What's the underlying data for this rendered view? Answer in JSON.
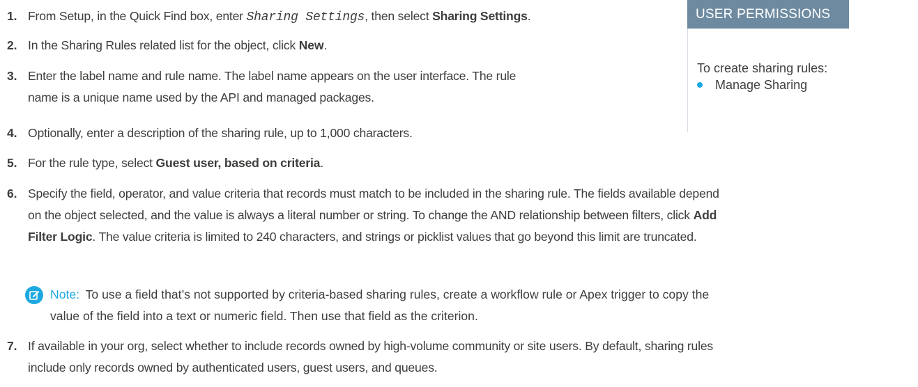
{
  "steps": [
    {
      "num": "1.",
      "parts": {
        "a": "From Setup, in the Quick Find box, enter ",
        "code": "Sharing Settings",
        "b": ", then select ",
        "bold": "Sharing Settings",
        "c": "."
      }
    },
    {
      "num": "2.",
      "parts": {
        "a": "In the Sharing Rules related list for the object, click ",
        "bold": "New",
        "b": "."
      }
    },
    {
      "num": "3.",
      "line1": "Enter the label name and rule name. The label name appears on the user interface. The rule",
      "line2": "name is a unique name used by the API and managed packages."
    },
    {
      "num": "4.",
      "text": "Optionally, enter a description of the sharing rule, up to 1,000 characters."
    },
    {
      "num": "5.",
      "parts": {
        "a": "For the rule type, select ",
        "bold": "Guest user, based on criteria",
        "b": "."
      }
    },
    {
      "num": "6.",
      "line1": "Specify the field, operator, and value criteria that records must match to be included in the sharing rule. The fields available depend",
      "line2a": "on the object selected, and the value is always a literal number or string. To change the AND relationship between filters, click ",
      "line2bold": "Add",
      "line3bold": "Filter Logic",
      "line3": ". The value criteria is limited to 240 characters, and strings or picklist values that go beyond this limit are truncated."
    },
    {
      "num": "7.",
      "line1": "If available in your org, select whether to include records owned by high-volume community or site users. By default, sharing rules",
      "line2": "include only records owned by authenticated users, guest users, and queues."
    }
  ],
  "note": {
    "label": "Note:",
    "line1": "To use a field that’s not supported by criteria-based sharing rules, create a workflow rule or Apex trigger to copy the",
    "line2": "value of the field into a text or numeric field. Then use that field as the criterion.",
    "icon": "note-edit-icon",
    "icon_color": "#1ea8e0"
  },
  "permissions": {
    "header": "USER PERMISSIONS",
    "header_color": "#6d8aa0",
    "description": "To create sharing rules:",
    "items": [
      "Manage Sharing"
    ]
  }
}
